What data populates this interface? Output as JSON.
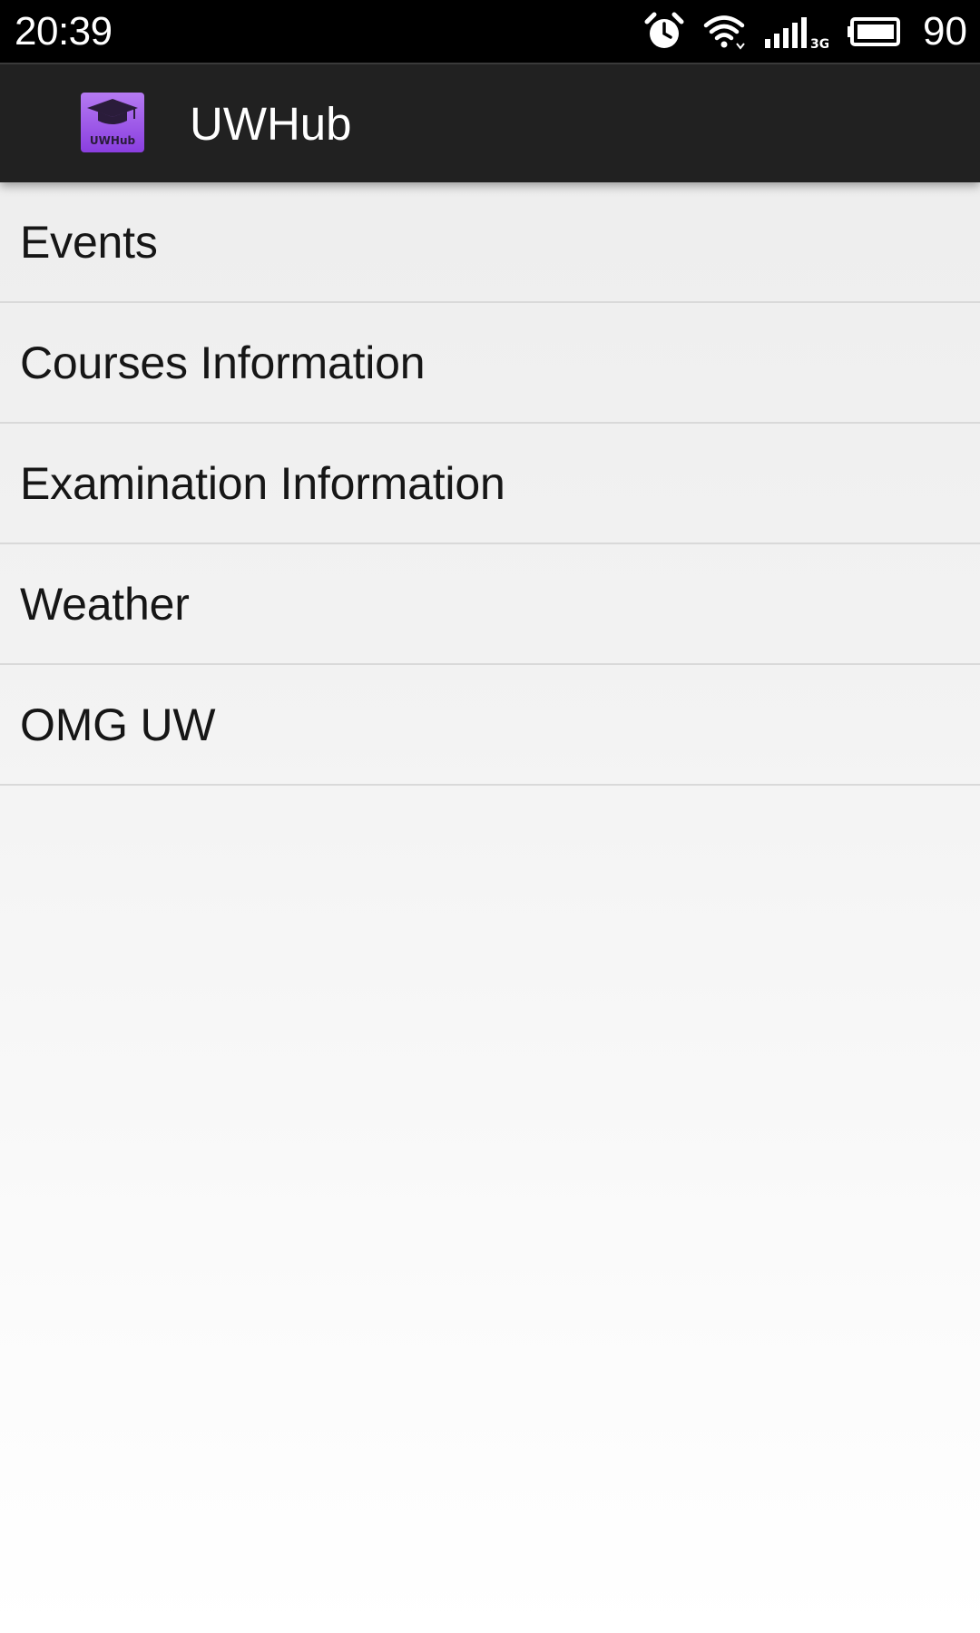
{
  "status_bar": {
    "time": "20:39",
    "battery_percent": "90",
    "network_type": "3G",
    "icons": [
      "alarm-icon",
      "wifi-icon",
      "cell-signal-icon",
      "battery-icon"
    ]
  },
  "app_bar": {
    "title": "UWHub",
    "icon_text": "UWHub",
    "icon_name": "uwhub-logo-icon",
    "colors": {
      "bar_background": "#212121",
      "icon_background": "#9a4ee6"
    }
  },
  "menu": {
    "items": [
      {
        "label": "Events"
      },
      {
        "label": "Courses Information"
      },
      {
        "label": "Examination Information"
      },
      {
        "label": "Weather"
      },
      {
        "label": "OMG UW"
      }
    ]
  }
}
